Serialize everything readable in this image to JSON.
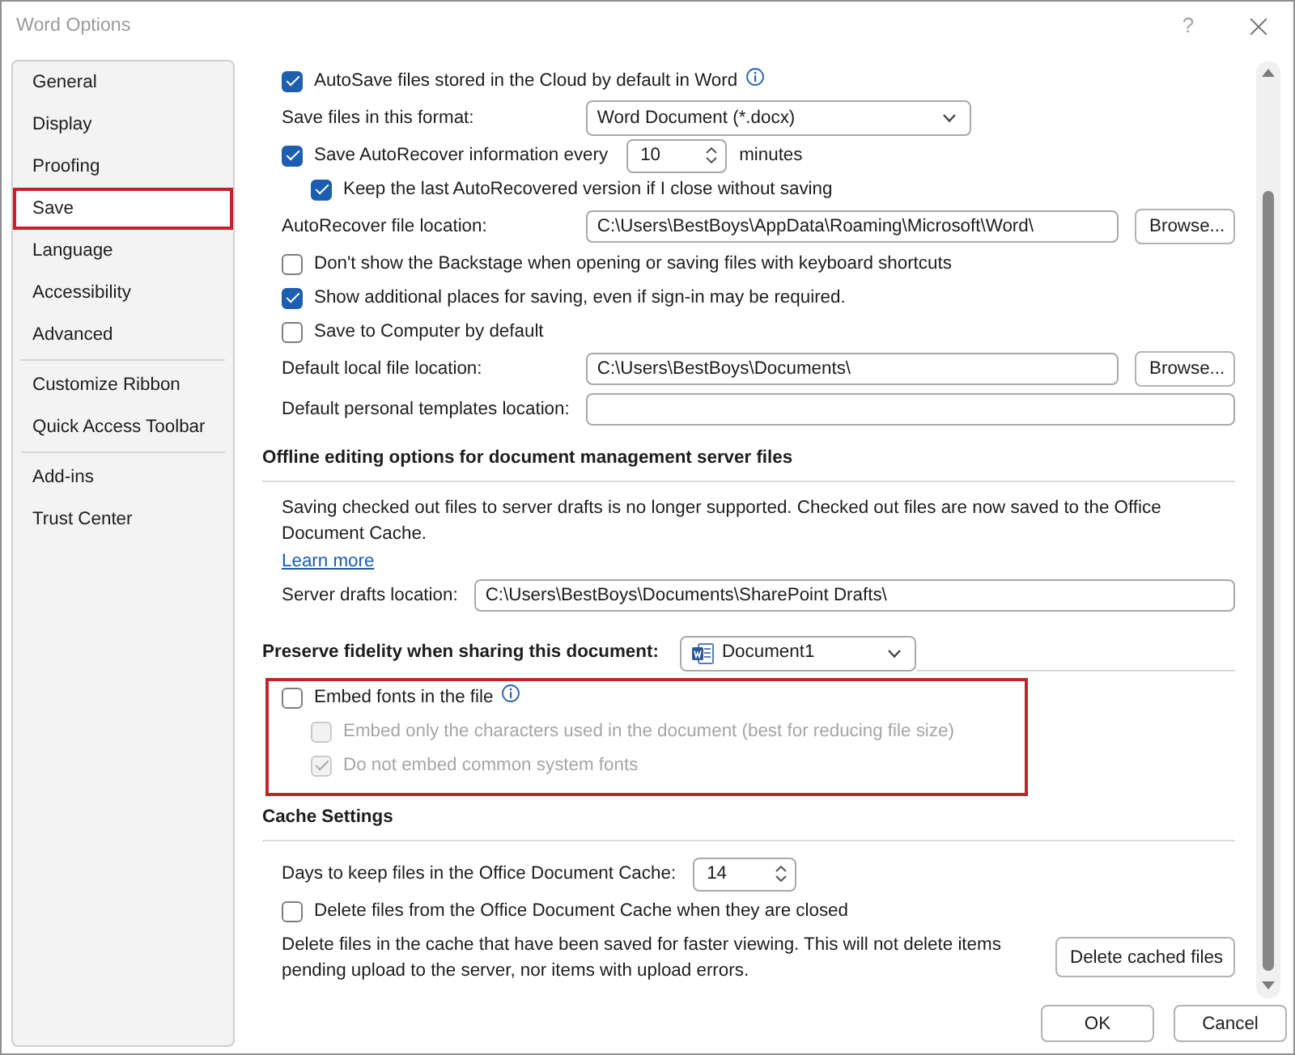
{
  "window": {
    "title": "Word Options",
    "help": "?"
  },
  "sidebar": {
    "groups": [
      {
        "items": [
          {
            "label": "General",
            "selected": false,
            "highlighted": false
          },
          {
            "label": "Display",
            "selected": false,
            "highlighted": false
          },
          {
            "label": "Proofing",
            "selected": false,
            "highlighted": false
          },
          {
            "label": "Save",
            "selected": true,
            "highlighted": true
          },
          {
            "label": "Language",
            "selected": false,
            "highlighted": false
          },
          {
            "label": "Accessibility",
            "selected": false,
            "highlighted": false
          },
          {
            "label": "Advanced",
            "selected": false,
            "highlighted": false
          }
        ]
      },
      {
        "items": [
          {
            "label": "Customize Ribbon",
            "selected": false,
            "highlighted": false
          },
          {
            "label": "Quick Access Toolbar",
            "selected": false,
            "highlighted": false
          }
        ]
      },
      {
        "items": [
          {
            "label": "Add-ins",
            "selected": false,
            "highlighted": false
          },
          {
            "label": "Trust Center",
            "selected": false,
            "highlighted": false
          }
        ]
      }
    ]
  },
  "sections": [
    {
      "highlighted": false,
      "rows": [
        {
          "kind": "checkbox",
          "label": "AutoSave files stored in the Cloud by default in Word",
          "checked": true,
          "disabled": false,
          "info": true
        },
        {
          "kind": "select",
          "label": "Save files in this format:",
          "value": "Word Document (*.docx)"
        },
        {
          "kind": "checkbox_spin",
          "label": "Save AutoRecover information every",
          "checked": true,
          "disabled": false,
          "value": "10",
          "unit": "minutes",
          "children": [
            {
              "kind": "checkbox",
              "label": "Keep the last AutoRecovered version if I close without saving",
              "checked": true,
              "disabled": false
            }
          ]
        },
        {
          "kind": "path",
          "label": "AutoRecover file location:",
          "value": "C:\\Users\\BestBoys\\AppData\\Roaming\\Microsoft\\Word\\",
          "button": "Browse..."
        },
        {
          "kind": "checkbox",
          "label": "Don't show the Backstage when opening or saving files with keyboard shortcuts",
          "checked": false,
          "disabled": false
        },
        {
          "kind": "checkbox",
          "label": "Show additional places for saving, even if sign-in may be required.",
          "checked": true,
          "disabled": false
        },
        {
          "kind": "checkbox",
          "label": "Save to Computer by default",
          "checked": false,
          "disabled": false
        },
        {
          "kind": "path",
          "label": "Default local file location:",
          "value": "C:\\Users\\BestBoys\\Documents\\",
          "button": "Browse..."
        },
        {
          "kind": "path",
          "label": "Default personal templates location:"
        }
      ]
    },
    {
      "heading": "Offline editing options for document management server files",
      "highlighted": false,
      "rows": [
        {
          "kind": "paragraph",
          "text": "Saving checked out files to server drafts is no longer supported. Checked out files are now saved to the Office Document Cache."
        },
        {
          "kind": "link",
          "text": "Learn more"
        },
        {
          "kind": "path",
          "label": "Server drafts location:",
          "value": "C:\\Users\\BestBoys\\Documents\\SharePoint Drafts\\"
        }
      ]
    },
    {
      "heading": "Preserve fidelity when sharing this document:",
      "document": "Document1",
      "highlighted": true,
      "rows": [
        {
          "kind": "checkbox",
          "label": "Embed fonts in the file",
          "checked": false,
          "disabled": false,
          "info": true,
          "children": [
            {
              "kind": "checkbox",
              "label": "Embed only the characters used in the document (best for reducing file size)",
              "checked": false,
              "disabled": true
            },
            {
              "kind": "checkbox",
              "label": "Do not embed common system fonts",
              "checked": true,
              "disabled": true
            }
          ]
        }
      ]
    },
    {
      "heading": "Cache Settings",
      "highlighted": false,
      "rows": [
        {
          "kind": "spin",
          "label": "Days to keep files in the Office Document Cache:",
          "value": "14"
        },
        {
          "kind": "checkbox",
          "label": "Delete files from the Office Document Cache when they are closed",
          "checked": false,
          "disabled": false
        },
        {
          "kind": "paragraph",
          "text": "Delete files in the cache that have been saved for faster viewing. This will not delete items pending upload to the server, nor items with upload errors.",
          "button": "Delete cached files"
        }
      ]
    }
  ],
  "buttons": [
    "OK",
    "Cancel"
  ]
}
